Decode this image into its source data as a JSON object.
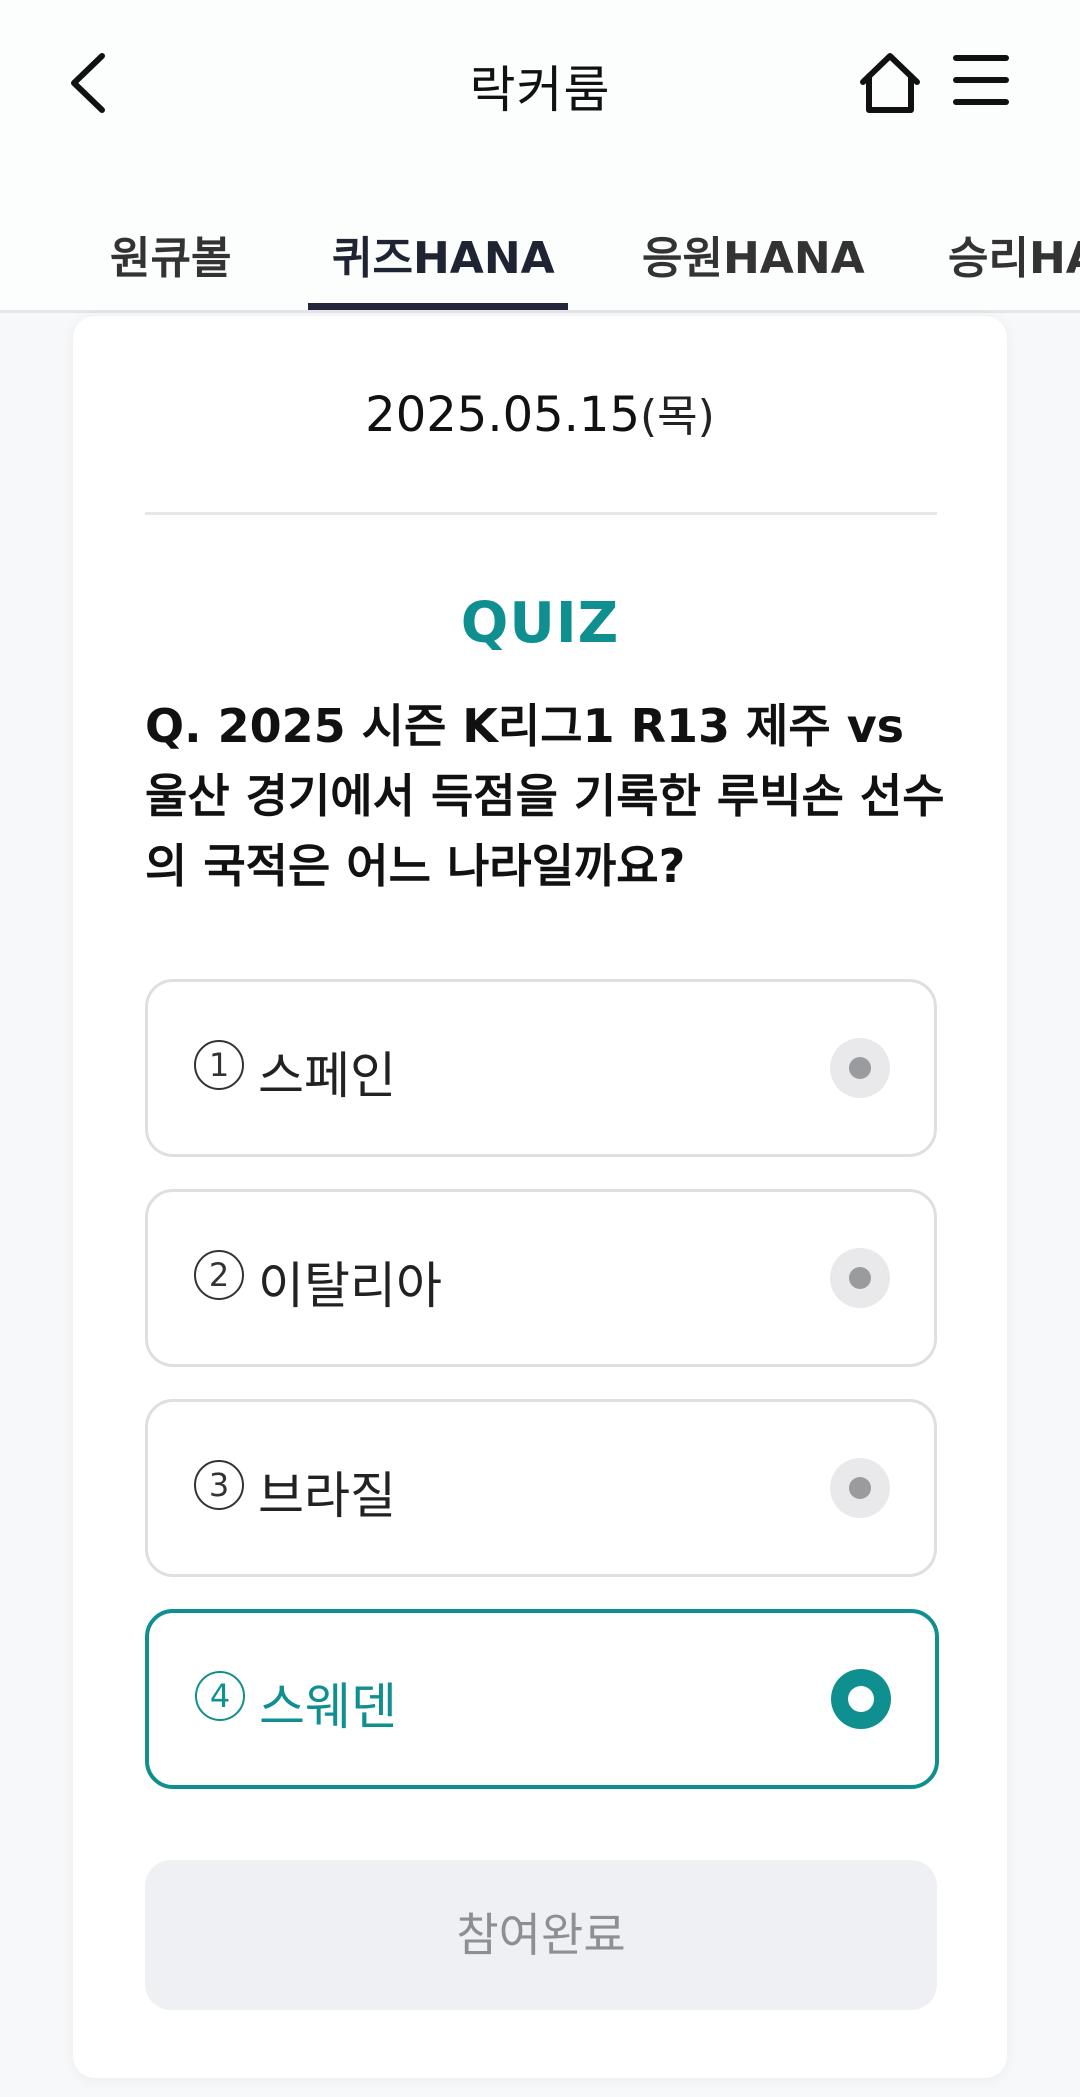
{
  "header": {
    "title": "락커룸",
    "back_icon": "chevron-left-icon",
    "home_icon": "home-icon",
    "menu_icon": "hamburger-menu-icon"
  },
  "tabs": [
    {
      "label": "원큐볼"
    },
    {
      "label": "퀴즈HANA",
      "active": true
    },
    {
      "label": "응원HANA"
    },
    {
      "label": "승리HANA"
    }
  ],
  "quiz": {
    "date": "2025.05.15",
    "day": "(목)",
    "label": "QUIZ",
    "question": "Q. 2025 시즌 K리그1 R13 제주 vs 울산 경기에서 득점을 기록한 루빅손 선수의 국적은 어느 나라일까요?",
    "options": [
      {
        "num": "1",
        "label": "스페인",
        "selected": false
      },
      {
        "num": "2",
        "label": "이탈리아",
        "selected": false
      },
      {
        "num": "3",
        "label": "브라질",
        "selected": false
      },
      {
        "num": "4",
        "label": "스웨덴",
        "selected": true
      }
    ],
    "submit_label": "참여완료"
  },
  "colors": {
    "accent": "#0f8f8f",
    "tab_indicator": "#232739",
    "disabled_button_bg": "#eff0f3",
    "disabled_button_text": "#8e8f93"
  }
}
